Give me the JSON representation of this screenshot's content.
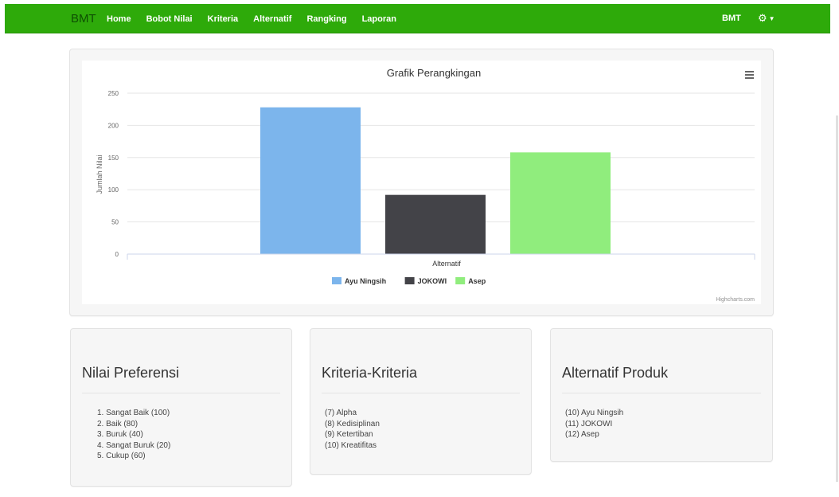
{
  "navbar": {
    "brand": "BMT",
    "links": [
      "Home",
      "Bobot Nilai",
      "Kriteria",
      "Alternatif",
      "Rangking",
      "Laporan"
    ],
    "user": "BMT",
    "settings_icon": "gear-icon"
  },
  "chart_data": {
    "type": "bar",
    "title": "Grafik Perangkingan",
    "xlabel": "Alternatif",
    "ylabel": "Jumlah Nilai",
    "ylim": [
      0,
      250
    ],
    "yticks": [
      0,
      50,
      100,
      150,
      200,
      250
    ],
    "grid": true,
    "legend_position": "bottom",
    "series": [
      {
        "name": "Ayu Ningsih",
        "values": [
          228
        ],
        "color": "#7cb5ec"
      },
      {
        "name": "JOKOWI",
        "values": [
          92
        ],
        "color": "#434348"
      },
      {
        "name": "Asep",
        "values": [
          158
        ],
        "color": "#90ed7d"
      }
    ],
    "credits": "Highcharts.com",
    "menu_icon": "hamburger-menu-icon"
  },
  "cards": [
    {
      "title": "Nilai Preferensi",
      "items": [
        "1. Sangat Baik (100)",
        "2. Baik (80)",
        "3. Buruk (40)",
        "4. Sangat Buruk (20)",
        "5. Cukup (60)"
      ]
    },
    {
      "title": "Kriteria-Kriteria",
      "items": [
        "(7) Alpha",
        "(8) Kedisiplinan",
        "(9) Ketertiban",
        "(10) Kreatifitas"
      ]
    },
    {
      "title": "Alternatif Produk",
      "items": [
        "(10) Ayu Ningsih",
        "(11) JOKOWI",
        "(12) Asep"
      ]
    }
  ]
}
